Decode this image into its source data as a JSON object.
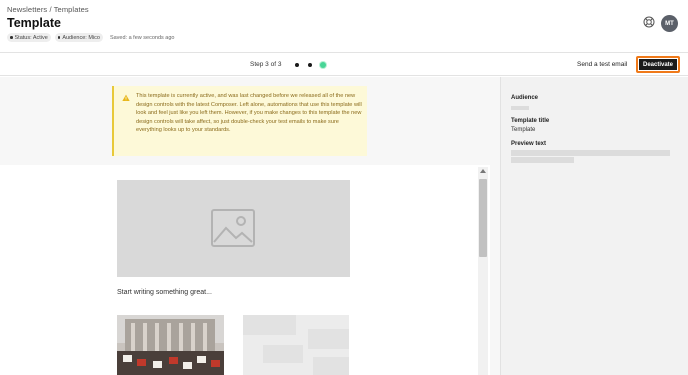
{
  "header": {
    "breadcrumb": "Newsletters / Templates",
    "title": "Template",
    "badges": [
      {
        "label": "Status: Active"
      },
      {
        "label": "Audience: Mico"
      }
    ],
    "saved": "Saved: a few seconds ago",
    "avatar_initials": "MT",
    "support_icon": "lifebuoy-icon"
  },
  "stepbar": {
    "step_label": "Step 3 of 3",
    "current_step": 3,
    "total_steps": 3,
    "send_test_label": "Send a test email",
    "deactivate_label": "Deactivate",
    "accent_active": "#48d597",
    "highlight_color": "#f07a1a"
  },
  "warning": {
    "icon": "warning-triangle-icon",
    "text": "This template is currently active, and was last changed before we released all of the new design controls with the latest Composer. Left alone, automations that use this template will look and feel just like you left them. However, if you make changes to this template the new design controls will take affect, so just double-check your test emails to make sure everything looks up to your standards."
  },
  "editor": {
    "image_placeholder_icon": "image-icon",
    "start_writing": "Start writing something great..."
  },
  "side": {
    "audience_label": "Audience",
    "template_title_label": "Template title",
    "template_title_value": "Template",
    "preview_text_label": "Preview text"
  }
}
